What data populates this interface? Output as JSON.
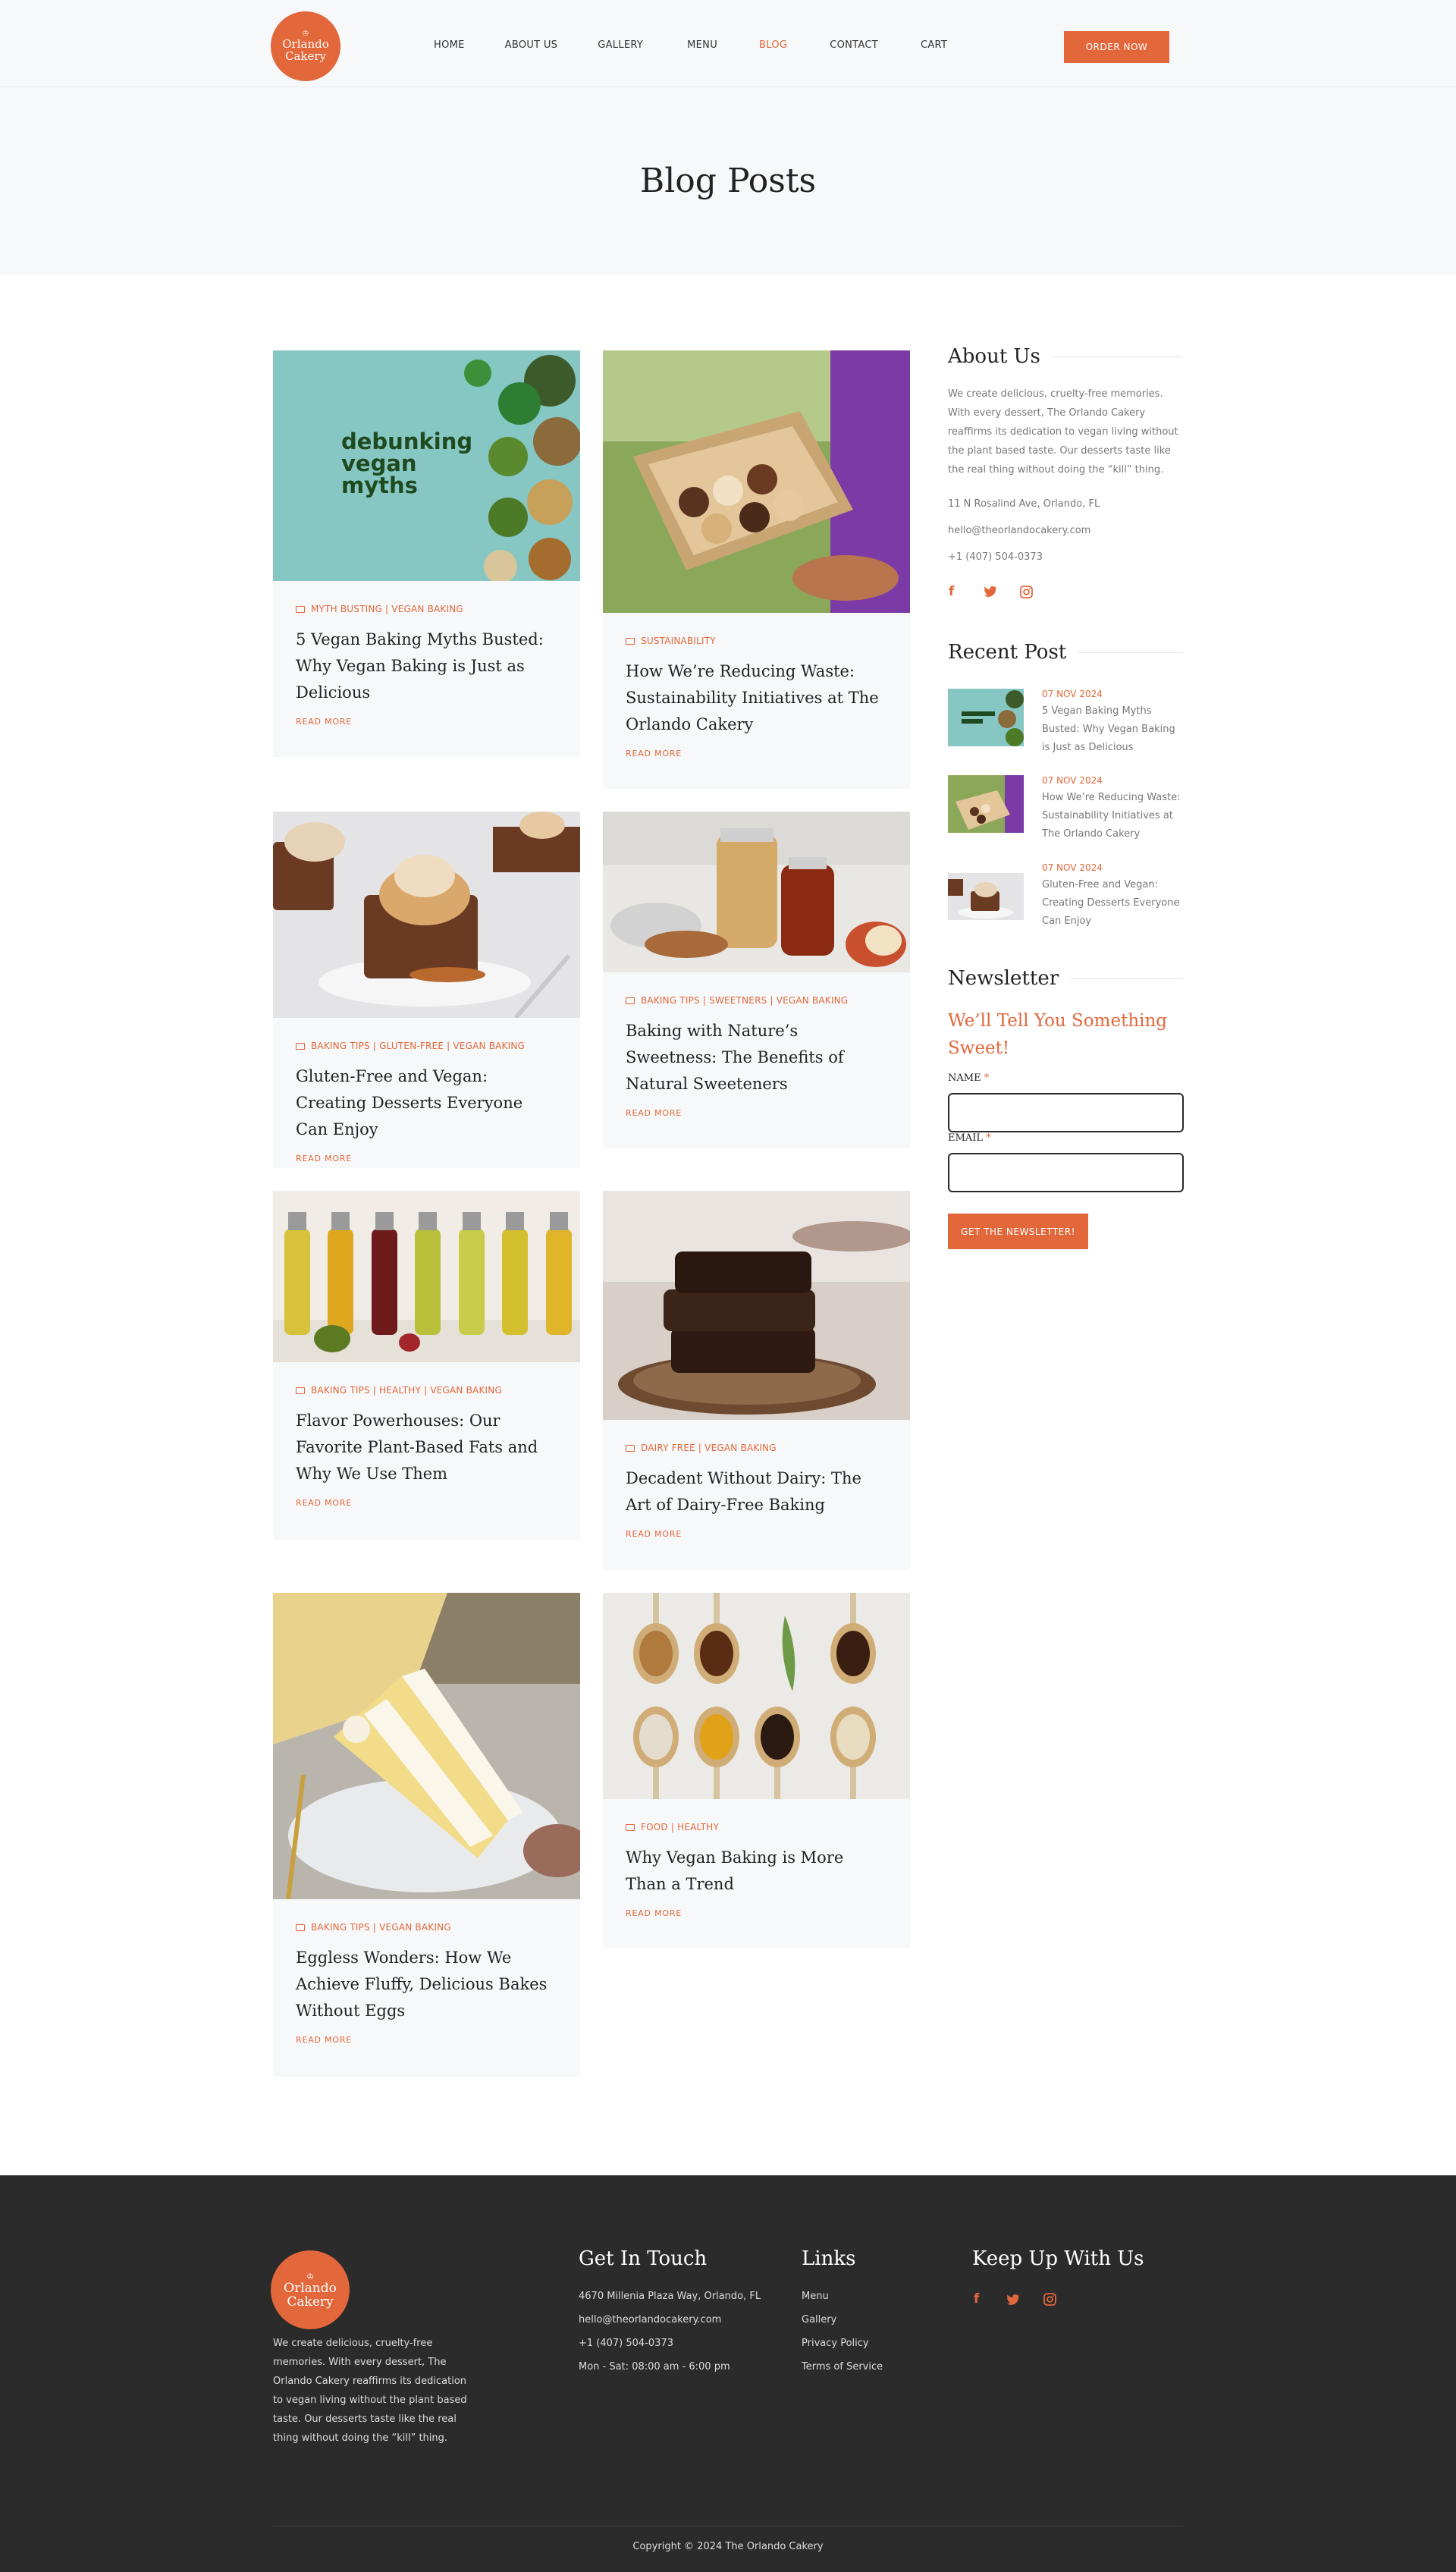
{
  "brand": {
    "name_line1": "Orlando",
    "name_line2": "Cakery"
  },
  "nav": {
    "items": [
      "HOME",
      "ABOUT US",
      "GALLERY",
      "MENU",
      "BLOG",
      "CONTACT",
      "CART"
    ],
    "active": "BLOG",
    "cta": "ORDER NOW"
  },
  "hero": {
    "title": "Blog Posts"
  },
  "posts": [
    {
      "category": "MYTH BUSTING | VEGAN BAKING",
      "title": "5 Vegan Baking Myths Busted: Why Vegan Baking is Just as Delicious",
      "read_more": "READ MORE",
      "image_text": "debunking vegan myths"
    },
    {
      "category": "SUSTAINABILITY",
      "title": "How We’re Reducing Waste: Sustainability Initiatives at The Orlando Cakery",
      "read_more": "READ MORE"
    },
    {
      "category": "BAKING TIPS | GLUTEN-FREE | VEGAN BAKING",
      "title": "Gluten-Free and Vegan: Creating Desserts Everyone Can Enjoy",
      "read_more": "READ MORE"
    },
    {
      "category": "BAKING TIPS | SWEETNERS | VEGAN BAKING",
      "title": "Baking with Nature’s Sweetness: The Benefits of Natural Sweeteners",
      "read_more": "READ MORE"
    },
    {
      "category": "BAKING TIPS | HEALTHY | VEGAN BAKING",
      "title": "Flavor Powerhouses: Our Favorite Plant-Based Fats and Why We Use Them",
      "read_more": "READ MORE"
    },
    {
      "category": "DAIRY FREE | VEGAN BAKING",
      "title": "Decadent Without Dairy: The Art of Dairy-Free Baking",
      "read_more": "READ MORE"
    },
    {
      "category": "BAKING TIPS | VEGAN BAKING",
      "title": "Eggless Wonders: How We Achieve Fluffy, Delicious Bakes Without Eggs",
      "read_more": "READ MORE"
    },
    {
      "category": "FOOD | HEALTHY",
      "title": "Why Vegan Baking is More Than a Trend",
      "read_more": "READ MORE"
    }
  ],
  "sidebar": {
    "about": {
      "heading": "About Us",
      "text": "We create delicious, cruelty-free memories. With every dessert, The Orlando Cakery reaffirms its dedication to vegan living without the plant based taste. Our desserts taste like the real thing without doing the “kill” thing.",
      "address": "11 N Rosalind Ave, Orlando, FL",
      "email": "hello@theorlandocakery.com",
      "phone": "+1 (407) 504-0373"
    },
    "recent": {
      "heading": "Recent Post",
      "items": [
        {
          "date": "07 NOV 2024",
          "title": "5 Vegan Baking Myths Busted: Why Vegan Baking is Just as Delicious"
        },
        {
          "date": "07 NOV 2024",
          "title": "How We’re Reducing Waste: Sustainability Initiatives at The Orlando Cakery"
        },
        {
          "date": "07 NOV 2024",
          "title": "Gluten-Free and Vegan: Creating Desserts Everyone Can Enjoy"
        }
      ]
    },
    "newsletter": {
      "heading": "Newsletter",
      "tagline": "We’ll Tell You Something Sweet!",
      "name_label": "NAME",
      "email_label": "EMAIL",
      "required_mark": "*",
      "button": "GET THE NEWSLETTER!"
    }
  },
  "footer": {
    "about": "We create delicious, cruelty-free memories. With every dessert, The Orlando Cakery reaffirms its dedication to vegan living without the plant based taste. Our desserts taste like the real thing without doing the “kill” thing.",
    "contact": {
      "heading": "Get In Touch",
      "address": "4670 Millenia Plaza Way, Orlando, FL",
      "email": "hello@theorlandocakery.com",
      "phone": "+1 (407) 504-0373",
      "hours": "Mon - Sat: 08:00 am - 6:00 pm"
    },
    "links": {
      "heading": "Links",
      "items": [
        "Menu",
        "Gallery",
        "Privacy Policy",
        "Terms of Service"
      ]
    },
    "social": {
      "heading": "Keep Up With Us",
      "icons": [
        "facebook-icon",
        "twitter-icon",
        "instagram-icon"
      ]
    },
    "copyright": "Copyright © 2024 The Orlando Cakery"
  },
  "colors": {
    "accent": "#e2673a",
    "light_bg": "#f7f8fa",
    "footer_bg": "#2b2b2b"
  }
}
